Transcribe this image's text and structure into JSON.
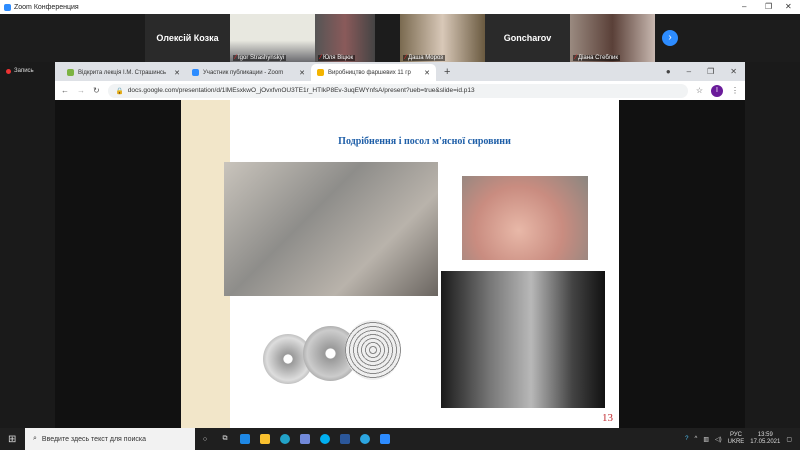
{
  "zoom": {
    "title": "Zoom Конференция",
    "record_label": "Запись"
  },
  "participants": [
    {
      "name": "Олексій Козка",
      "video": false
    },
    {
      "name": "Igor Strashynskyi",
      "video": true
    },
    {
      "name": "Юля Віцюк",
      "video": true
    },
    {
      "name": "Даша Мороз",
      "video": true
    },
    {
      "name": "Goncharov",
      "video": false
    },
    {
      "name": "Діана Стеблик",
      "video": true
    }
  ],
  "browser": {
    "tabs": [
      {
        "label": "Відкрита лекція І.М. Страшинсь",
        "active": false,
        "color": "#7cb342"
      },
      {
        "label": "Участник публикации - Zoom",
        "active": false,
        "color": "#2d8cff"
      },
      {
        "label": "Виробництво фаршевих 11 гр",
        "active": true,
        "color": "#f4b400"
      }
    ],
    "url": "docs.google.com/presentation/d/1lMEsxkwO_jOvxfvnOU3TE1r_HTIkP8Ev-3uqEWYnfsA/present?ueb=true&slide=id.p13",
    "profile_initial": "I"
  },
  "slide": {
    "title": "Подрібнення і посол м'ясної сировини",
    "number": "13"
  },
  "taskbar": {
    "search_placeholder": "Введите здесь текст для поиска",
    "lang": "РУС",
    "layout": "UKRE",
    "time": "13:59",
    "date": "17.05.2021"
  }
}
